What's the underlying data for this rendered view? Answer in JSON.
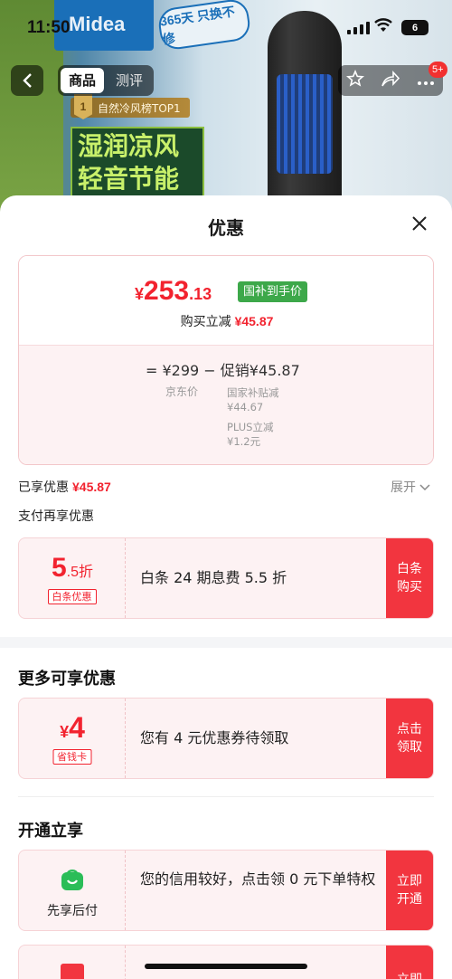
{
  "status_bar": {
    "time": "11:50",
    "battery": "6"
  },
  "background": {
    "brand_logo": "Midea",
    "badge": "365天 只换不修",
    "ranking": "自然冷风榜TOP1",
    "ranking_num": "1",
    "slogan_line1": "湿润凉风",
    "slogan_line2": "轻音节能"
  },
  "nav": {
    "tabs": [
      {
        "label": "商品"
      },
      {
        "label": "测评"
      }
    ],
    "badge": "5+"
  },
  "sheet": {
    "title": "优惠",
    "price_card": {
      "currency": "¥",
      "price_int": "253",
      "price_dec": ".13",
      "tag": "国补到手价",
      "reduce_label": "购买立减",
      "reduce_amount": "¥45.87",
      "formula": "=  ¥299  −  促销¥45.87",
      "jd_price_label": "京东价",
      "subsidy_label": "国家补贴减",
      "subsidy_amount": "¥44.67",
      "plus_label": "PLUS立减",
      "plus_amount": "¥1.2元"
    },
    "enjoyed_label": "已享优惠",
    "enjoyed_amount": "¥45.87",
    "expand_label": "展开",
    "pay_more_label": "支付再享优惠",
    "baitiao": {
      "big": "5",
      "small": ".5折",
      "tag": "白条优惠",
      "desc": "白条 24 期息费 5.5 折",
      "action": "白条购买"
    },
    "more_title": "更多可享优惠",
    "coupon": {
      "currency": "¥",
      "big": "4",
      "tag": "省钱卡",
      "desc": "您有 4 元优惠券待领取",
      "action": "点击领取"
    },
    "open_title": "开通立享",
    "paylater": {
      "label": "先享后付",
      "desc": "您的信用较好，点击领 0 元下单特权",
      "action": "立即开通"
    },
    "partial": {
      "action": "立即"
    }
  },
  "colors": {
    "accent": "#f2232f",
    "tag_green": "#3da84a",
    "action_bg": "#f2353f",
    "card_bg": "#fdf2f3"
  },
  "icons": [
    "back-icon",
    "star-icon",
    "share-icon",
    "more-icon",
    "close-icon",
    "chevron-down-icon",
    "shopping-bag-icon",
    "card-icon"
  ]
}
